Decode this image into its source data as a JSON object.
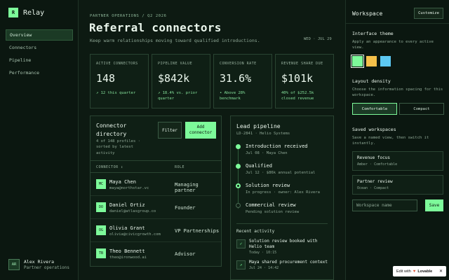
{
  "app": {
    "brand_mark": "R",
    "brand_name": "Relay"
  },
  "nav": [
    {
      "label": "Overview",
      "active": true
    },
    {
      "label": "Connectors",
      "active": false
    },
    {
      "label": "Pipeline",
      "active": false
    },
    {
      "label": "Performance",
      "active": false
    }
  ],
  "user": {
    "initials": "AR",
    "name": "Alex Rivera",
    "role": "Partner operations"
  },
  "header": {
    "eyebrow": "PARTNER OPERATIONS / Q2 2026",
    "title": "Referral connectors",
    "subtitle": "Keep warm relationships moving toward qualified introductions.",
    "date": "WED · JUL 29"
  },
  "stats": [
    {
      "label": "ACTIVE CONNECTORS",
      "value": "148",
      "note": "↗ 12 this quarter"
    },
    {
      "label": "PIPELINE VALUE",
      "value": "$842k",
      "note": "↗ 18.4% vs. prior quarter"
    },
    {
      "label": "CONVERSION RATE",
      "value": "31.6%",
      "note": "• Above 28% benchmark"
    },
    {
      "label": "REVENUE SHARE DUE",
      "value": "$101k",
      "note": "40% of $252.5k closed revenue"
    }
  ],
  "directory": {
    "title": "Connector directory",
    "meta": "4 of 148 profiles · sorted by latest activity",
    "filter_label": "Filter",
    "add_label": "Add connector",
    "col_connector": "CONNECTOR ↕",
    "col_role": "ROLE",
    "rows": [
      {
        "initials": "MC",
        "name": "Maya Chen",
        "email": "maya@northstar.vc",
        "role": "Managing partner"
      },
      {
        "initials": "DO",
        "name": "Daniel Ortiz",
        "email": "daniel@atlasgroup.co",
        "role": "Founder"
      },
      {
        "initials": "OG",
        "name": "Olivia Grant",
        "email": "olivia@civicgrowth.com",
        "role": "VP Partnerships"
      },
      {
        "initials": "TB",
        "name": "Theo Bennett",
        "email": "theo@ironwood.ai",
        "role": "Advisor"
      }
    ]
  },
  "pipeline": {
    "title": "Lead pipeline",
    "subtitle": "LD-2841 · Helio Systems",
    "steps": [
      {
        "title": "Introduction received",
        "meta": "Jul 08 · Maya Chen",
        "state": "done"
      },
      {
        "title": "Qualified",
        "meta": "Jul 12 · $86k annual potential",
        "state": "done"
      },
      {
        "title": "Solution review",
        "meta": "In progress · owner: Alex Rivera",
        "state": "current"
      },
      {
        "title": "Commercial review",
        "meta": "Pending solution review",
        "state": "pending"
      }
    ],
    "activity_title": "Recent activity",
    "activity": [
      {
        "icon": "check-icon",
        "glyph": "✓",
        "text": "Solution review booked with Helio team",
        "time": "Today · 10:15"
      },
      {
        "icon": "arrow-icon",
        "glyph": "↗",
        "text": "Maya shared procurement context",
        "time": "Jul 24 · 14:42"
      }
    ]
  },
  "panel": {
    "title": "Workspace",
    "customize_label": "Customize",
    "theme_heading": "Interface theme",
    "theme_desc": "Apply an appearance to every active view.",
    "swatches": [
      "#7dfa9a",
      "#f5c04a",
      "#5cc8f2"
    ],
    "density_heading": "Layout density",
    "density_desc": "Choose the information spacing for this workspace.",
    "density_options": [
      "Comfortable",
      "Compact"
    ],
    "saved_heading": "Saved workspaces",
    "saved_desc": "Save a named view, then switch it instantly.",
    "workspaces": [
      {
        "name": "Revenue focus",
        "meta": "Amber · Comfortable"
      },
      {
        "name": "Partner review",
        "meta": "Ocean · Compact"
      }
    ],
    "input_placeholder": "Workspace name",
    "save_label": "Save"
  },
  "badge": {
    "prefix": "Edit with",
    "brand": "Lovable",
    "close": "✕"
  },
  "colors": {
    "accent": "#7dfa9a",
    "background": "#0d1a12"
  }
}
